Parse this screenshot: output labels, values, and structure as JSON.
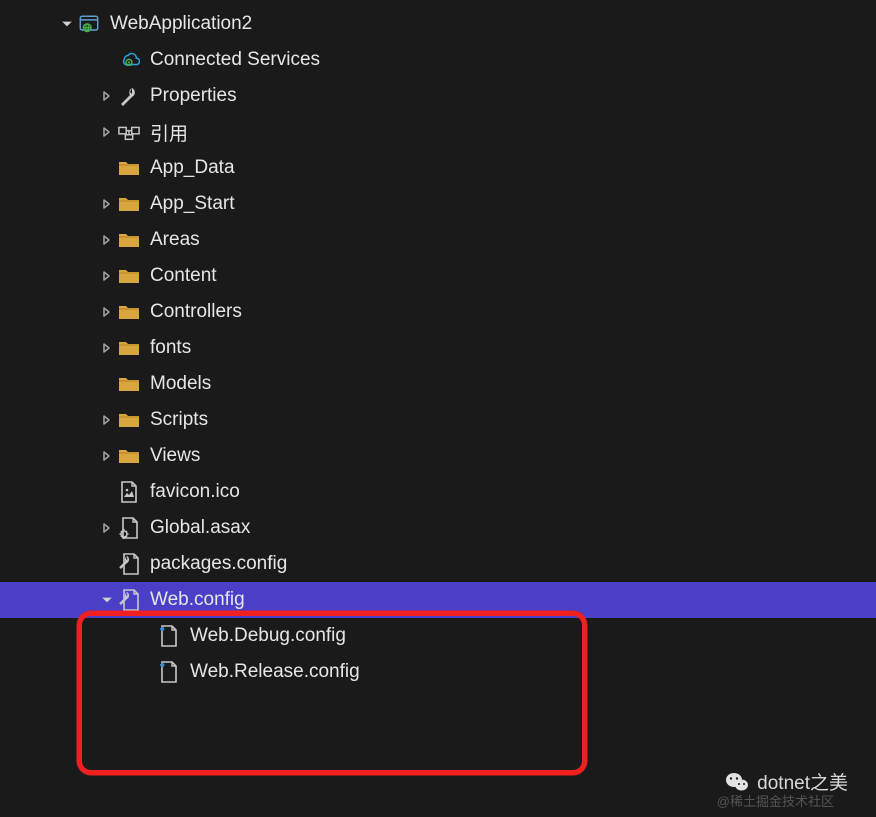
{
  "tree": {
    "project": {
      "label": "WebApplication2",
      "expanded": true
    },
    "items": [
      {
        "label": "Connected Services",
        "icon": "cloud-plug",
        "expander": "none",
        "level": 1
      },
      {
        "label": "Properties",
        "icon": "wrench",
        "expander": "closed",
        "level": 1
      },
      {
        "label": "引用",
        "icon": "references",
        "expander": "closed",
        "level": 1
      },
      {
        "label": "App_Data",
        "icon": "folder",
        "expander": "none",
        "level": 1
      },
      {
        "label": "App_Start",
        "icon": "folder",
        "expander": "closed",
        "level": 1
      },
      {
        "label": "Areas",
        "icon": "folder",
        "expander": "closed",
        "level": 1
      },
      {
        "label": "Content",
        "icon": "folder",
        "expander": "closed",
        "level": 1
      },
      {
        "label": "Controllers",
        "icon": "folder",
        "expander": "closed",
        "level": 1
      },
      {
        "label": "fonts",
        "icon": "folder",
        "expander": "closed",
        "level": 1
      },
      {
        "label": "Models",
        "icon": "folder",
        "expander": "none",
        "level": 1
      },
      {
        "label": "Scripts",
        "icon": "folder",
        "expander": "closed",
        "level": 1
      },
      {
        "label": "Views",
        "icon": "folder",
        "expander": "closed",
        "level": 1
      },
      {
        "label": "favicon.ico",
        "icon": "image-file",
        "expander": "none",
        "level": 1
      },
      {
        "label": "Global.asax",
        "icon": "file-gear",
        "expander": "closed",
        "level": 1
      },
      {
        "label": "packages.config",
        "icon": "config-file",
        "expander": "none",
        "level": 1
      },
      {
        "label": "Web.config",
        "icon": "config-file",
        "expander": "open",
        "level": 1,
        "selected": true
      },
      {
        "label": "Web.Debug.config",
        "icon": "transform-file",
        "expander": "none",
        "level": 2
      },
      {
        "label": "Web.Release.config",
        "icon": "transform-file",
        "expander": "none",
        "level": 2
      }
    ]
  },
  "watermark": {
    "main": "dotnet之美",
    "faint": "@稀土掘金技术社区"
  }
}
